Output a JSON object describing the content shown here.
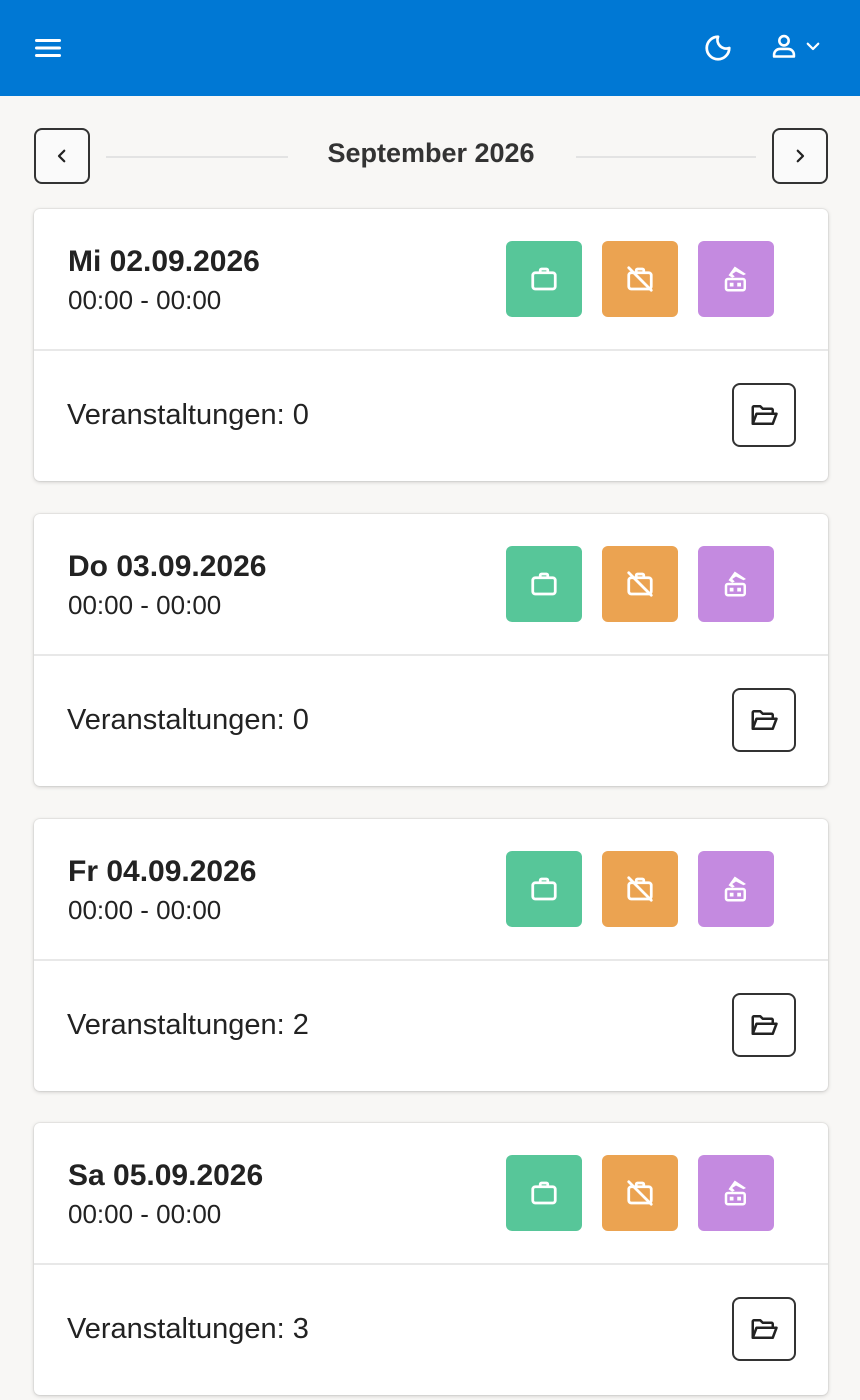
{
  "header": {
    "menu_icon": "hamburger-menu-icon",
    "theme_icon": "moon-icon",
    "user_icon": "user-icon",
    "dropdown_icon": "chevron-down-icon",
    "color": "#0078d4"
  },
  "month_nav": {
    "title": "September 2026",
    "prev_icon": "chevron-left-icon",
    "next_icon": "chevron-right-icon"
  },
  "actions": {
    "work_icon": "briefcase-icon",
    "no_work_icon": "briefcase-off-icon",
    "travel_icon": "luggage-plane-icon",
    "colors": {
      "work": "#57c699",
      "no_work": "#eba351",
      "travel": "#c48ae0"
    }
  },
  "days": [
    {
      "date": "Mi 02.09.2026",
      "time": "00:00 - 00:00",
      "events": "Veranstaltungen: 0"
    },
    {
      "date": "Do 03.09.2026",
      "time": "00:00 - 00:00",
      "events": "Veranstaltungen: 0"
    },
    {
      "date": "Fr 04.09.2026",
      "time": "00:00 - 00:00",
      "events": "Veranstaltungen: 2"
    },
    {
      "date": "Sa 05.09.2026",
      "time": "00:00 - 00:00",
      "events": "Veranstaltungen: 3"
    }
  ]
}
